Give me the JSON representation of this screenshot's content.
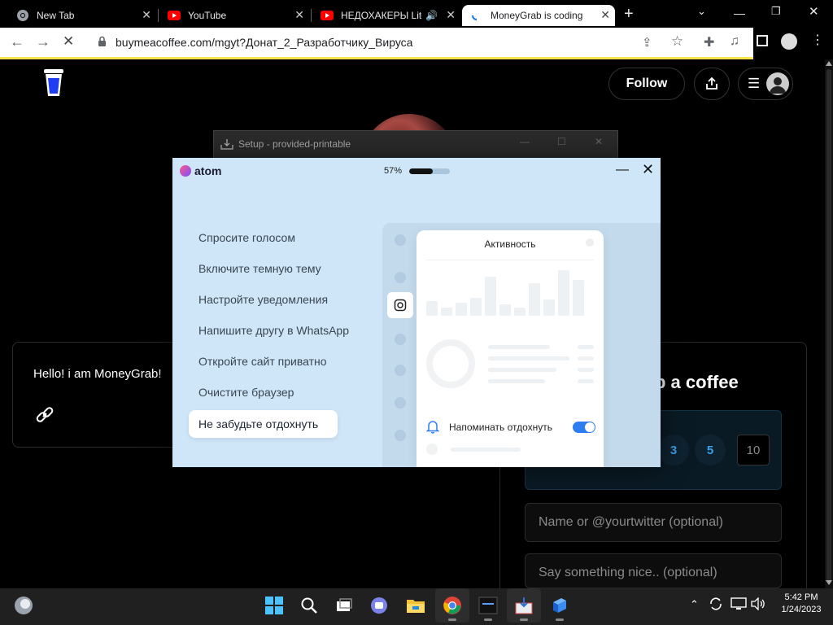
{
  "browser": {
    "tabs": [
      {
        "title": "New Tab",
        "icon": "chrome-icon"
      },
      {
        "title": "YouTube",
        "icon": "youtube-icon"
      },
      {
        "title": "НЕДОХАКЕРЫ Lite",
        "icon": "youtube-icon"
      },
      {
        "title": "MoneyGrab is coding",
        "icon": "loading-icon"
      }
    ],
    "new_tab_label": "+",
    "url": "buymeacoffee.com/mgyt?Донат_2_Разработчику_Вируса"
  },
  "page": {
    "follow_label": "Follow",
    "intro_text": "Hello! i am MoneyGrab!",
    "support_title": "b a coffee",
    "amounts": [
      "3",
      "5",
      "10"
    ],
    "name_placeholder": "Name or @yourtwitter (optional)",
    "message_placeholder": "Say something nice.. (optional)"
  },
  "setup_window": {
    "title": "Setup - provided-printable"
  },
  "atom": {
    "logo": "atom",
    "progress_text": "57%",
    "progress_value": 0.57,
    "tips": [
      "Спросите голосом",
      "Включите темную тему",
      "Настройте уведомления",
      "Напишите другу в WhatsApp",
      "Откройте сайт приватно",
      "Очистите браузер"
    ],
    "active_tip": "Не забудьте отдохнуть",
    "card_title": "Активность",
    "remind_label": "Напоминать отдохнуть",
    "remind_enabled": true
  },
  "taskbar": {
    "time": "5:42 PM",
    "date": "1/24/2023"
  },
  "colors": {
    "accent": "#2e7df0",
    "loading_bar": "#fbe34a",
    "amount_text": "#3aa0e8"
  }
}
